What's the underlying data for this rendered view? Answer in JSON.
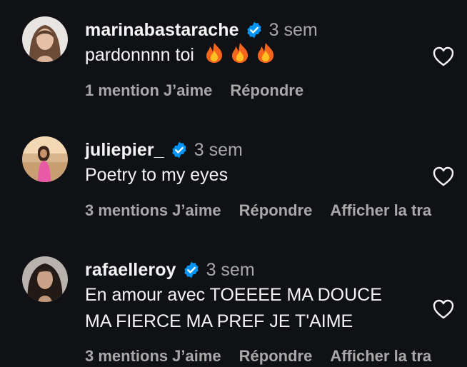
{
  "comments": [
    {
      "username": "marinabastarache",
      "time": "3 sem",
      "text": "pardonnnn toi",
      "emoji": [
        "fire-emoji",
        "fire-emoji",
        "fire-emoji"
      ],
      "likes": "1 mention",
      "like_label": "J’aime",
      "reply_label": "Répondre"
    },
    {
      "username": "juliepier_",
      "time": "3 sem",
      "text": "Poetry to my eyes",
      "likes": "3 mentions",
      "like_label": "J’aime",
      "reply_label": "Répondre",
      "translate_label": "Afficher la tra"
    },
    {
      "username": "rafaelleroy",
      "time": "3 sem",
      "text_line1": "En amour avec TOEEEE MA DOUCE",
      "text_line2": "MA FIERCE MA PREF JE T'AIME",
      "likes": "3 mentions",
      "like_label": "J’aime",
      "reply_label": "Répondre",
      "translate_label": "Afficher la tra"
    }
  ],
  "colors": {
    "background": "#0f1115",
    "text": "#f5f5f5",
    "muted": "#a8a8a8",
    "verified": "#0095f6"
  },
  "icons": {
    "verified": "verified-badge-icon",
    "like": "heart-outline-icon"
  }
}
